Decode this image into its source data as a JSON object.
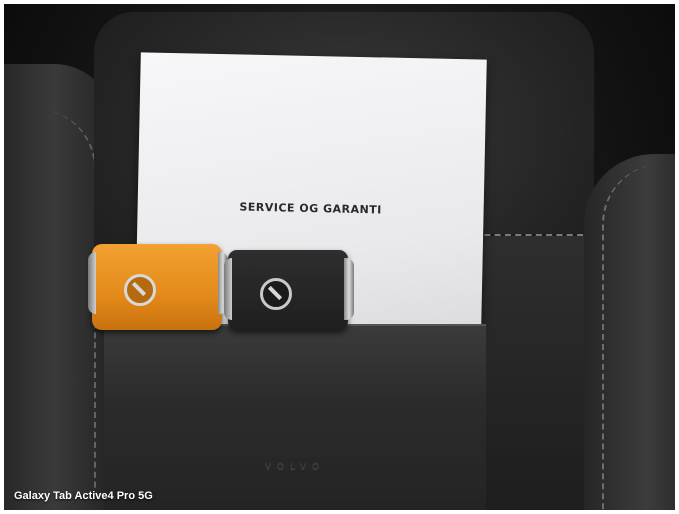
{
  "photo": {
    "booklet_title": "SERVICE OG GARANTI",
    "box_logo": "VOLVO",
    "caption": "Galaxy Tab Active4 Pro 5G",
    "colors": {
      "key_orange": "#e48a1a",
      "key_black": "#1f1f1f",
      "booklet": "#ececef",
      "box": "#2b2b2b"
    },
    "icons": {
      "orange_key_emblem": "volvo-iron-mark-icon",
      "black_key_emblem": "volvo-iron-mark-icon"
    }
  }
}
